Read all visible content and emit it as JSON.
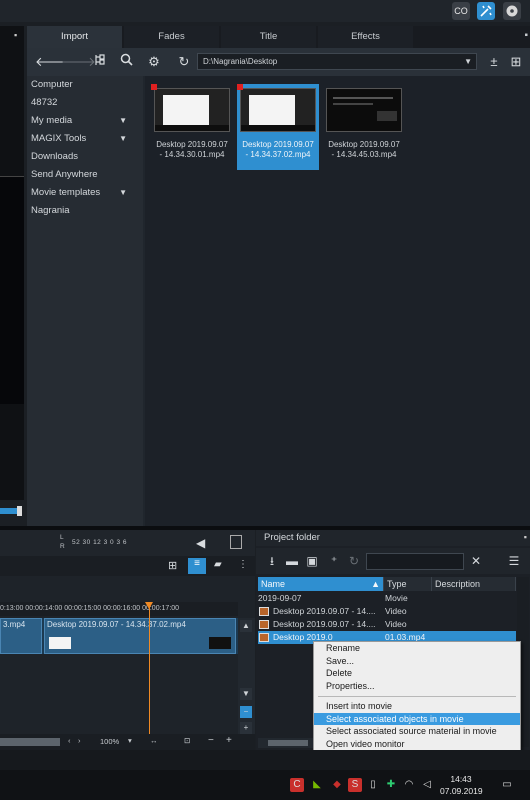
{
  "colors": {
    "accent": "#2f8fd0",
    "playhead": "#f08a24",
    "menu_highlight": "#3a9be0",
    "marker": "#e02020"
  },
  "topbar": {
    "icons": [
      "co-icon",
      "wrench-magic-icon",
      "disc-icon"
    ],
    "co_text": "CO"
  },
  "media_browser": {
    "tabs": [
      {
        "label": "Import"
      },
      {
        "label": "Fades"
      },
      {
        "label": "Title"
      },
      {
        "label": "Effects"
      }
    ],
    "path": "D:\\Nagrania\\Desktop",
    "sidebar": [
      {
        "label": "Computer"
      },
      {
        "label": "48732"
      },
      {
        "label": "My media"
      },
      {
        "label": "MAGIX Tools"
      },
      {
        "label": "Downloads"
      },
      {
        "label": "Send Anywhere"
      },
      {
        "label": "Movie templates"
      },
      {
        "label": "Nagrania"
      }
    ],
    "files": [
      {
        "line1": "Desktop 2019.09.07",
        "line2": "- 14.34.30.01.mp4"
      },
      {
        "line1": "Desktop 2019.09.07",
        "line2": "- 14.34.37.02.mp4"
      },
      {
        "line1": "Desktop 2019.09.07",
        "line2": "- 14.34.45.03.mp4"
      }
    ]
  },
  "timeline": {
    "meter": {
      "l": "L",
      "r": "R",
      "values": "52  30  12    3   0  3  6"
    },
    "ruler": "0:13:00 00:00:14:00 00:00:15:00 00:00:16:00 00:00:17:00",
    "clips": [
      {
        "label": "3.mp4"
      },
      {
        "label": "Desktop 2019.09.07 - 14.34.37.02.mp4"
      }
    ],
    "zoom": "100%"
  },
  "project_folder": {
    "title": "Project folder",
    "columns": {
      "name": "Name",
      "type": "Type",
      "description": "Description"
    },
    "group": "2019-09-07",
    "group_type": "Movie",
    "rows": [
      {
        "name": "Desktop 2019.09.07 - 14....",
        "type": "Video"
      },
      {
        "name": "Desktop 2019.09.07 - 14....",
        "type": "Video"
      },
      {
        "name": "Desktop 2019.0",
        "type": "01.03.mp4"
      }
    ]
  },
  "context_menu": {
    "group1": [
      "Rename",
      "Save...",
      "Delete",
      "Properties..."
    ],
    "group2": [
      "Insert into movie",
      "Select associated objects in movie",
      "Select associated source material in movie",
      "Open video monitor"
    ]
  },
  "taskbar": {
    "time": "14:43",
    "date": "07.09.2019"
  }
}
